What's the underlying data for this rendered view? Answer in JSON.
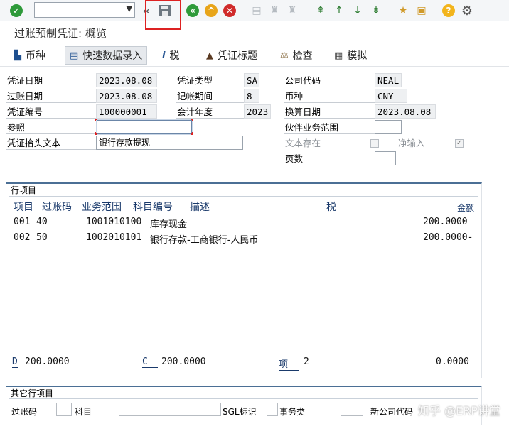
{
  "toolbar": {
    "command_value": "",
    "icons": [
      "check-icon",
      "back-icon",
      "save-icon",
      "exit-icon",
      "up-icon",
      "cancel-icon",
      "print-icon",
      "find-icon",
      "find-next-icon",
      "first-page-icon",
      "prev-page-icon",
      "next-page-icon",
      "last-page-icon",
      "new-session-icon",
      "shortcut-icon",
      "help-icon",
      "settings-icon"
    ]
  },
  "title": "过账预制凭证: 概览",
  "app_toolbar": {
    "currency": "币种",
    "fast_entry": "快速数据录入",
    "tax": "税",
    "doc_header": "凭证标题",
    "check": "检查",
    "simulate": "模拟"
  },
  "header": {
    "doc_date_label": "凭证日期",
    "doc_date": "2023.08.08",
    "doc_type_label": "凭证类型",
    "doc_type": "SA",
    "company_label": "公司代码",
    "company": "NEAL",
    "post_date_label": "过账日期",
    "post_date": "2023.08.08",
    "period_label": "记帐期间",
    "period": "8",
    "currency_label": "币种",
    "currency": "CNY",
    "doc_no_label": "凭证编号",
    "doc_no": "100000001",
    "fiscal_year_label": "会计年度",
    "fiscal_year": "2023",
    "trans_date_label": "换算日期",
    "trans_date": "2023.08.08",
    "reference_label": "参照",
    "reference": "",
    "partner_ba_label": "伙伴业务范围",
    "partner_ba": "",
    "header_text_label": "凭证抬头文本",
    "header_text": "银行存款提现",
    "text_exists_label": "文本存在",
    "net_entry_label": "净输入",
    "pages_label": "页数",
    "pages": ""
  },
  "items": {
    "panel_title": "行项目",
    "columns": {
      "item": "项目",
      "posting_key": "过账码",
      "business_area": "业务范围",
      "account": "科目编号",
      "description": "描述",
      "tax": "税",
      "amount": "金额"
    },
    "rows": [
      {
        "item": "001",
        "pk": "40",
        "account": "1001010100",
        "desc": "库存现金",
        "amount": "200.0000"
      },
      {
        "item": "002",
        "pk": "50",
        "account": "1002010101",
        "desc": "银行存款-工商银行-人民币",
        "amount": "200.0000-"
      }
    ],
    "totals": {
      "d_label": "D",
      "d_value": "200.0000",
      "c_label": "C",
      "c_value": "200.0000",
      "items_label": "项",
      "items_value": "2",
      "balance": "0.0000"
    }
  },
  "other_items": {
    "panel_title": "其它行项目",
    "posting_key_label": "过账码",
    "account_label": "科目",
    "sgl_label": "SGL标识",
    "trans_type_label": "事务类",
    "new_company_label": "新公司代码"
  },
  "watermark": "知乎 @ERP讲堂"
}
